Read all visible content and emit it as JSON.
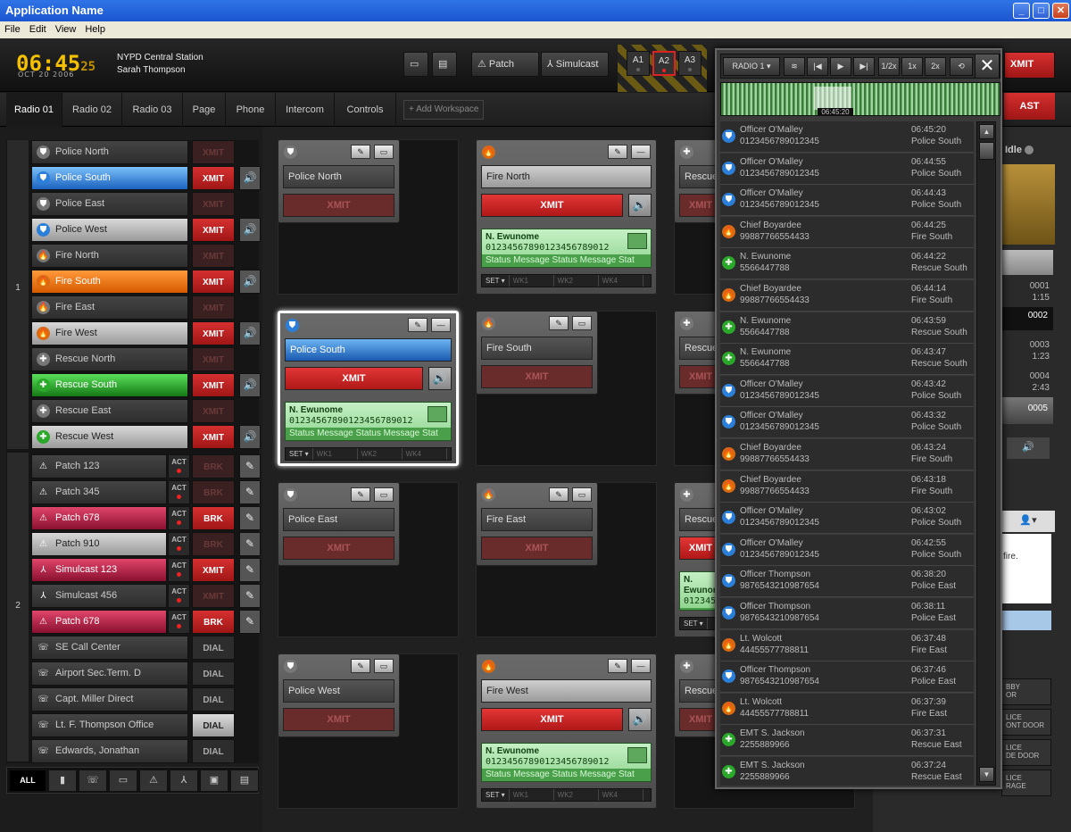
{
  "window": {
    "title": "Application Name"
  },
  "menu": [
    "File",
    "Edit",
    "View",
    "Help"
  ],
  "header": {
    "time": "06:45",
    "seconds": "25",
    "date": "OCT 20 2006",
    "station": "NYPD Central Station",
    "user": "Sarah Thompson",
    "patch_label": "Patch",
    "simulcast_label": "Simulcast",
    "a1": "A1",
    "a2": "A2",
    "a3": "A3",
    "xmit": "XMIT",
    "east": "AST"
  },
  "tabs": [
    "Radio 01",
    "Radio 02",
    "Radio 03",
    "Page",
    "Phone",
    "Intercom",
    "Controls"
  ],
  "add_workspace": "+ Add Workspace",
  "groups": [
    "1",
    "2"
  ],
  "channels": [
    {
      "name": "Police North",
      "btn": "XMIT",
      "type": "police"
    },
    {
      "name": "Police South",
      "btn": "XMIT",
      "type": "police"
    },
    {
      "name": "Police East",
      "btn": "XMIT",
      "type": "police"
    },
    {
      "name": "Police West",
      "btn": "XMIT",
      "type": "police"
    },
    {
      "name": "Fire North",
      "btn": "XMIT",
      "type": "fire"
    },
    {
      "name": "Fire South",
      "btn": "XMIT",
      "type": "fire"
    },
    {
      "name": "Fire East",
      "btn": "XMIT",
      "type": "fire"
    },
    {
      "name": "Fire West",
      "btn": "XMIT",
      "type": "fire"
    },
    {
      "name": "Rescue North",
      "btn": "XMIT",
      "type": "rescue"
    },
    {
      "name": "Rescue South",
      "btn": "XMIT",
      "type": "rescue"
    },
    {
      "name": "Rescue East",
      "btn": "XMIT",
      "type": "rescue"
    },
    {
      "name": "Rescue West",
      "btn": "XMIT",
      "type": "rescue"
    },
    {
      "name": "Patch 123",
      "btn": "BRK",
      "act": "ACT",
      "type": "patch"
    },
    {
      "name": "Patch 345",
      "btn": "BRK",
      "act": "ACT",
      "type": "patch"
    },
    {
      "name": "Patch 678",
      "btn": "BRK",
      "act": "ACT",
      "type": "patch"
    },
    {
      "name": "Patch 910",
      "btn": "BRK",
      "act": "ACT",
      "type": "patch"
    },
    {
      "name": "Simulcast 123",
      "btn": "XMIT",
      "act": "ACT",
      "type": "simulcast"
    },
    {
      "name": "Simulcast 456",
      "btn": "XMIT",
      "act": "ACT",
      "type": "simulcast"
    },
    {
      "name": "Patch 678",
      "btn": "BRK",
      "act": "ACT",
      "type": "patch"
    },
    {
      "name": "SE Call Center",
      "btn": "DIAL",
      "type": "phone"
    },
    {
      "name": "Airport Sec.Term. D",
      "btn": "DIAL",
      "type": "phone"
    },
    {
      "name": "Capt. Miller Direct",
      "btn": "DIAL",
      "type": "phone"
    },
    {
      "name": "Lt. F. Thompson Office",
      "btn": "DIAL",
      "type": "phone"
    },
    {
      "name": "Edwards, Jonathan",
      "btn": "DIAL",
      "type": "phone"
    }
  ],
  "filter_all": "ALL",
  "cards": [
    {
      "name": "Police North",
      "btn": "XMIT"
    },
    {
      "name": "Fire North",
      "btn": "XMIT"
    },
    {
      "name": "Rescue",
      "btn": "XMIT"
    },
    {
      "name": "Police South",
      "btn": "XMIT"
    },
    {
      "name": "Fire South",
      "btn": "XMIT"
    },
    {
      "name": "Rescue",
      "btn": "XMIT"
    },
    {
      "name": "Police East",
      "btn": "XMIT"
    },
    {
      "name": "Fire East",
      "btn": "XMIT"
    },
    {
      "name": "Rescue",
      "btn": "XMIT"
    },
    {
      "name": "Police West",
      "btn": "XMIT"
    },
    {
      "name": "Fire West",
      "btn": "XMIT"
    },
    {
      "name": "Rescue",
      "btn": "XMIT"
    }
  ],
  "status": {
    "name": "N. Ewunome",
    "number": "01234567890123456789012",
    "message": "Status Message Status Message Stat",
    "set": "SET ▾",
    "wk1": "WK1",
    "wk2": "WK2",
    "wk4": "WK4"
  },
  "popup": {
    "radio": "RADIO 1 ▾",
    "half": "1/2x",
    "one": "1x",
    "two": "2x",
    "wavetime": "06:45:20"
  },
  "log": [
    {
      "name": "Officer O'Malley",
      "id": "012345678901 2345",
      "time": "06:45:20",
      "ch": "Police South",
      "type": "police"
    },
    {
      "name": "Officer O'Malley",
      "id": "0123456789012345",
      "time": "06:44:55",
      "ch": "Police South",
      "type": "police"
    },
    {
      "name": "Officer O'Malley",
      "id": "0123456789012345",
      "time": "06:44:43",
      "ch": "Police South",
      "type": "police"
    },
    {
      "name": "Chief Boyardee",
      "id": "99887766554433",
      "time": "06:44:25",
      "ch": "Fire South",
      "type": "fire"
    },
    {
      "name": "N. Ewunome",
      "id": "5566447788",
      "time": "06:44:22",
      "ch": "Rescue South",
      "type": "rescue"
    },
    {
      "name": "Chief Boyardee",
      "id": "99887766554433",
      "time": "06:44:14",
      "ch": "Fire South",
      "type": "fire"
    },
    {
      "name": "N. Ewunome",
      "id": "5566447788",
      "time": "06:43:59",
      "ch": "Rescue South",
      "type": "rescue"
    },
    {
      "name": "N. Ewunome",
      "id": "5566447788",
      "time": "06:43:47",
      "ch": "Rescue South",
      "type": "rescue"
    },
    {
      "name": "Officer O'Malley",
      "id": "0123456789012345",
      "time": "06:43:42",
      "ch": "Police South",
      "type": "police"
    },
    {
      "name": "Officer O'Malley",
      "id": "0123456789012345",
      "time": "06:43:32",
      "ch": "Police South",
      "type": "police"
    },
    {
      "name": "Chief Boyardee",
      "id": "99887766554433",
      "time": "06:43:24",
      "ch": "Fire South",
      "type": "fire"
    },
    {
      "name": "Chief Boyardee",
      "id": "99887766554433",
      "time": "06:43:18",
      "ch": "Fire South",
      "type": "fire"
    },
    {
      "name": "Officer O'Malley",
      "id": "0123456789012345",
      "time": "06:43:02",
      "ch": "Police South",
      "type": "police"
    },
    {
      "name": "Officer O'Malley",
      "id": "0123456789012345",
      "time": "06:42:55",
      "ch": "Police South",
      "type": "police"
    },
    {
      "name": "Officer Thompson",
      "id": "9876543210987654",
      "time": "06:38:20",
      "ch": "Police East",
      "type": "police"
    },
    {
      "name": "Officer Thompson",
      "id": "9876543210987654",
      "time": "06:38:11",
      "ch": "Police East",
      "type": "police"
    },
    {
      "name": "Lt. Wolcott",
      "id": "44455577788811",
      "time": "06:37:48",
      "ch": "Fire East",
      "type": "fire"
    },
    {
      "name": "Officer Thompson",
      "id": "9876543210987654",
      "time": "06:37:46",
      "ch": "Police East",
      "type": "police"
    },
    {
      "name": "Lt. Wolcott",
      "id": "44455577788811",
      "time": "06:37:39",
      "ch": "Fire East",
      "type": "fire"
    },
    {
      "name": "EMT S. Jackson",
      "id": "2255889966",
      "time": "06:37:31",
      "ch": "Rescue East",
      "type": "rescue"
    },
    {
      "name": "EMT S. Jackson",
      "id": "2255889966",
      "time": "06:37:24",
      "ch": "Rescue East",
      "type": "rescue"
    }
  ],
  "right": {
    "idle": "Idle",
    "r1": "0001",
    "r1t": "1:15",
    "r2": "0002",
    "r3": "0003",
    "r3t": "1:23",
    "r4": "0004",
    "r4t": "2:43",
    "r5": "0005",
    "fire_text": "fire.",
    "l1": "BBY",
    "l1b": "OR",
    "l2": "LICE",
    "l2b": "ONT DOOR",
    "l3": "LICE",
    "l3b": "DE DOOR",
    "l4": "LICE",
    "l4b": "RAGE"
  }
}
